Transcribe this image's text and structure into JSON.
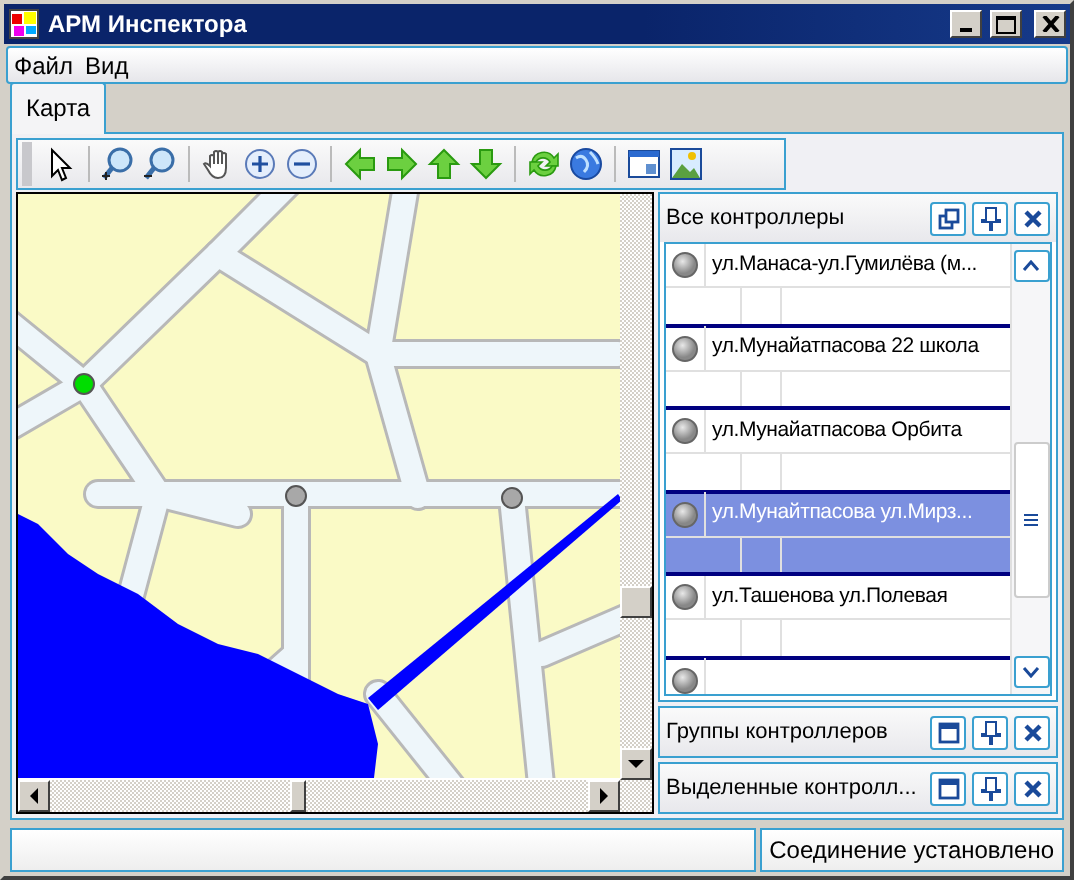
{
  "window": {
    "title": "АРМ Инспектора"
  },
  "menu": [
    "Файл",
    "Вид"
  ],
  "tabs": [
    {
      "label": "Карта",
      "selected": true
    }
  ],
  "map": {
    "markers": [
      {
        "color": "#00dd00"
      },
      {
        "color": "#a8a8a8"
      },
      {
        "color": "#a8a8a8"
      }
    ]
  },
  "panels": [
    {
      "title": "Все контроллеры",
      "expanded": true,
      "items": [
        {
          "name": "ул.Манаса-ул.Гумилёва (м...",
          "selected": false
        },
        {
          "name": "ул.Мунайатпасова 22 школа",
          "selected": false
        },
        {
          "name": "ул.Мунайатпасова Орбита",
          "selected": false
        },
        {
          "name": "ул.Мунайтпасова ул.Мирз...",
          "selected": true
        },
        {
          "name": "ул.Ташенова ул.Полевая",
          "selected": false
        }
      ]
    },
    {
      "title": "Группы контроллеров",
      "expanded": false
    },
    {
      "title": "Выделенные контролл...",
      "expanded": false
    }
  ],
  "status_bar": {
    "text": "Соединение установлено"
  }
}
